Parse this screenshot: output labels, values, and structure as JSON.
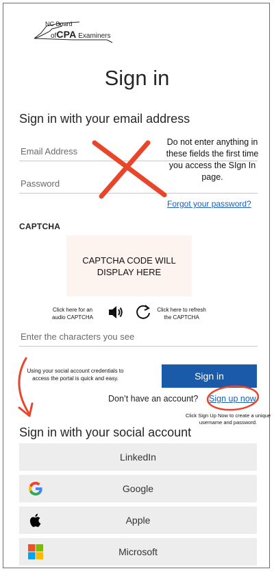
{
  "logo": {
    "line1": "NC Board",
    "line2_prefix": "of",
    "line2_bold": "CPA",
    "line2_suffix": "Examiners"
  },
  "page": {
    "title": "Sign in",
    "email_heading": "Sign in with your email address"
  },
  "form": {
    "email_placeholder": "Email Address",
    "password_placeholder": "Password",
    "forgot_link": "Forgot your password?",
    "captcha_label": "CAPTCHA",
    "captcha_placeholder_text": "CAPTCHA CODE WILL DISPLAY HERE",
    "captcha_input_placeholder": "Enter the characters you see",
    "signin_button": "Sign in",
    "no_account_text": "Don’t have an account?",
    "signup_link": "Sign up now"
  },
  "annotations": {
    "do_not_enter": "Do not enter anything in these fields the first time you access the SIgn In page.",
    "audio_note": "Click here for an audio CAPTCHA",
    "refresh_note": "Click here to refresh the CAPTCHA",
    "social_note": "Using your social account credentials to access the portal is quick and easy.",
    "signup_note": "Click Sign Up Now to create a unique username and password.",
    "accent_color": "#e8452b"
  },
  "social": {
    "heading": "Sign in with your social account",
    "providers": [
      {
        "label": "LinkedIn",
        "icon": "none"
      },
      {
        "label": "Google",
        "icon": "google-icon"
      },
      {
        "label": "Apple",
        "icon": "apple-icon"
      },
      {
        "label": "Microsoft",
        "icon": "microsoft-icon"
      }
    ]
  },
  "colors": {
    "primary_button": "#1a5aa8",
    "link": "#1a5fb4",
    "social_button_bg": "#ededed",
    "captcha_bg": "#fdf3ef"
  }
}
